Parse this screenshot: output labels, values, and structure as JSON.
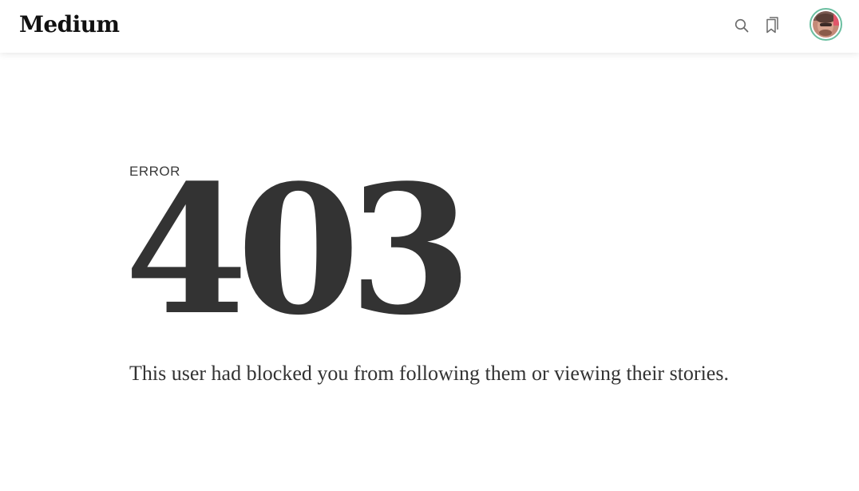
{
  "header": {
    "logo_text": "Medium",
    "search_icon": "search-icon",
    "bookmark_icon": "bookmarks-icon",
    "avatar": "user-avatar"
  },
  "error": {
    "label": "ERROR",
    "code": "403",
    "message": "This user had blocked you from following them or viewing their stories."
  },
  "colors": {
    "text": "#333333",
    "avatar_ring": "#6bbfa1",
    "icon": "#6b6b6b"
  }
}
